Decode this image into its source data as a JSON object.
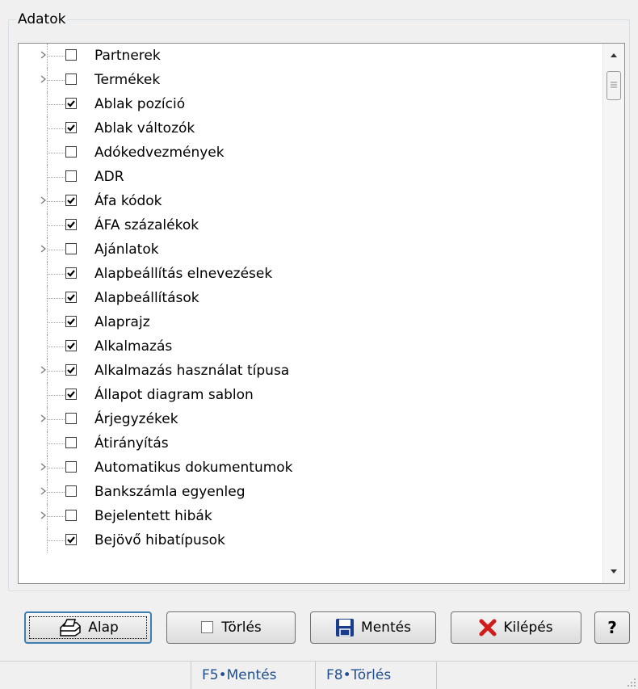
{
  "group": {
    "title": "Adatok"
  },
  "tree": {
    "items": [
      {
        "label": "Partnerek",
        "checked": false,
        "expandable": true
      },
      {
        "label": "Termékek",
        "checked": false,
        "expandable": true
      },
      {
        "label": "Ablak pozíció",
        "checked": true,
        "expandable": false
      },
      {
        "label": "Ablak változók",
        "checked": true,
        "expandable": false
      },
      {
        "label": "Adókedvezmények",
        "checked": false,
        "expandable": false
      },
      {
        "label": "ADR",
        "checked": false,
        "expandable": false
      },
      {
        "label": "Áfa kódok",
        "checked": true,
        "expandable": true
      },
      {
        "label": "ÁFA százalékok",
        "checked": true,
        "expandable": false
      },
      {
        "label": "Ajánlatok",
        "checked": false,
        "expandable": true
      },
      {
        "label": "Alapbeállítás elnevezések",
        "checked": true,
        "expandable": false
      },
      {
        "label": "Alapbeállítások",
        "checked": true,
        "expandable": false
      },
      {
        "label": "Alaprajz",
        "checked": true,
        "expandable": false
      },
      {
        "label": "Alkalmazás",
        "checked": true,
        "expandable": false
      },
      {
        "label": "Alkalmazás használat típusa",
        "checked": true,
        "expandable": true
      },
      {
        "label": "Állapot diagram sablon",
        "checked": true,
        "expandable": false
      },
      {
        "label": "Árjegyzékek",
        "checked": false,
        "expandable": true
      },
      {
        "label": "Átirányítás",
        "checked": false,
        "expandable": false
      },
      {
        "label": "Automatikus dokumentumok",
        "checked": false,
        "expandable": true
      },
      {
        "label": "Bankszámla egyenleg",
        "checked": false,
        "expandable": true
      },
      {
        "label": "Bejelentett hibák",
        "checked": false,
        "expandable": true
      },
      {
        "label": "Bejövő hibatípusok",
        "checked": true,
        "expandable": false
      }
    ]
  },
  "buttons": {
    "alap": "Alap",
    "torles": "Törlés",
    "mentes": "Mentés",
    "kilepes": "Kilépés",
    "help": "?"
  },
  "status": {
    "f5": "F5•Mentés",
    "f8": "F8•Törlés"
  },
  "icons": {
    "alap": "printer-icon",
    "torles": "checkbox-icon",
    "mentes": "floppy-disk-icon",
    "kilepes": "red-x-icon",
    "scroll_up": "chevron-up-icon",
    "scroll_down": "chevron-down-icon",
    "grip": "resize-grip-icon"
  },
  "colors": {
    "status_text": "#1f4f8f",
    "exit_x": "#d11a1a",
    "floppy": "#1a3c8c"
  }
}
